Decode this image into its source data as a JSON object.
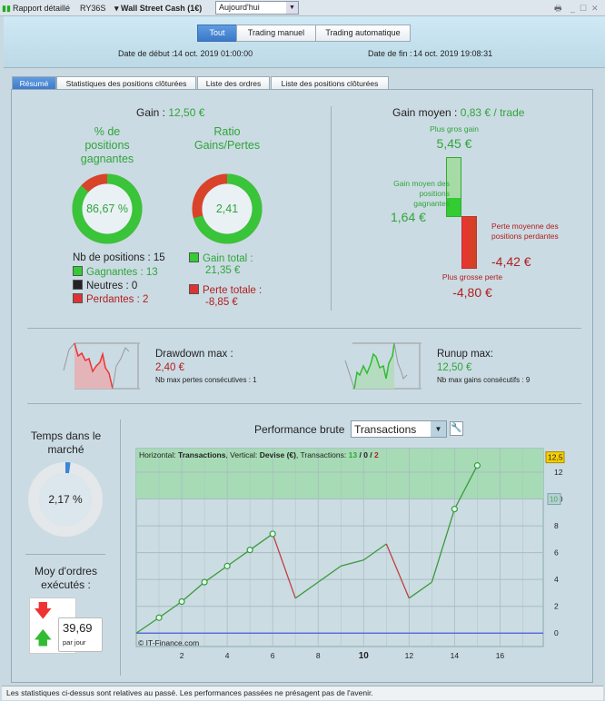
{
  "topbar": {
    "title": "Rapport détaillé",
    "account": "RY36S",
    "instrument": "Wall Street Cash (1€)",
    "period": "Aujourd'hui"
  },
  "header": {
    "filters": [
      "Tout",
      "Trading manuel",
      "Trading automatique"
    ],
    "start_label": "Date de début :",
    "start_value": "14 oct. 2019 01:00:00",
    "end_label": "Date de fin :",
    "end_value": "14 oct. 2019 19:08:31"
  },
  "tabs": [
    "Résumé",
    "Statistiques des positions clôturées",
    "Liste des ordres",
    "Liste des positions clôturées"
  ],
  "summary": {
    "gain_label": "Gain :",
    "gain_value": "12,50 €",
    "win_title": "% de positions gagnantes",
    "win_value": "86,67 %",
    "win_fraction": 0.8667,
    "ratio_title": "Ratio Gains/Pertes",
    "ratio_value": "2,41",
    "ratio_win_share": 0.707,
    "nb_positions": "Nb de positions : 15",
    "winners": "Gagnantes : 13",
    "neutral": "Neutres : 0",
    "losers": "Perdantes : 2",
    "gain_total_label": "Gain total :",
    "gain_total_value": "21,35 €",
    "loss_total_label": "Perte totale :",
    "loss_total_value": "-8,85 €"
  },
  "average": {
    "label": "Gain moyen :",
    "value": "0,83 € / trade",
    "max_gain_label": "Plus gros gain",
    "max_gain_value": "5,45 €",
    "avg_win_label": "Gain moyen des positions gagnantes",
    "avg_win_value": "1,64 €",
    "avg_loss_label": "Perte moyenne des positions perdantes",
    "avg_loss_value": "-4,42 €",
    "max_loss_label": "Plus grosse perte",
    "max_loss_value": "-4,80 €"
  },
  "drawdown": {
    "label": "Drawdown max :",
    "value": "2,40 €",
    "sub": "Nb max pertes consécutives : 1"
  },
  "runup": {
    "label": "Runup max:",
    "value": "12,50 €",
    "sub": "Nb max gains consécutifs : 9"
  },
  "time_market": {
    "label": "Temps dans le marché",
    "value": "2,17 %",
    "fraction": 0.0217
  },
  "orders": {
    "label": "Moy d'ordres exécutés :",
    "value": "39,69",
    "unit": "par jour"
  },
  "perf": {
    "title": "Performance brute",
    "select": "Transactions",
    "info_h": "Horizontal:",
    "info_h_v": "Transactions",
    "info_v": ", Vertical:",
    "info_v_v": "Devise (€)",
    "info_t": ", Transactions:",
    "t_win": "13",
    "t_sep1": " / ",
    "t_neu": "0",
    "t_sep2": " / ",
    "t_loss": "2",
    "copyright": "© IT-Finance.com"
  },
  "chart_data": {
    "type": "line",
    "xlabel": "",
    "ylabel": "",
    "xlim": [
      0,
      17.9
    ],
    "ylim": [
      -1,
      13.76
    ],
    "grid": true,
    "x": [
      0,
      1,
      2,
      3,
      4,
      5,
      6,
      7,
      8,
      9,
      10,
      11,
      12,
      13,
      14,
      15
    ],
    "y": [
      0,
      1.15,
      2.35,
      3.8,
      5.0,
      6.2,
      7.4,
      2.6,
      3.8,
      5.0,
      5.45,
      6.65,
      2.6,
      3.8,
      9.25,
      12.5
    ],
    "markers_at": [
      1,
      2,
      3,
      4,
      5,
      6,
      14,
      15
    ],
    "x_ticks": [
      2,
      4,
      6,
      8,
      10,
      12,
      14,
      16
    ],
    "y_ticks": [
      0,
      2,
      4,
      6,
      8,
      10,
      12
    ],
    "zone_above": 10,
    "zone_label": "10",
    "last_value_label": "12,5",
    "colors": {
      "up": "#3a9a3a",
      "down": "#c04040",
      "zero": "#4a5ae0",
      "zone": "#a6dbb5"
    }
  },
  "footer": "Les statistiques ci-dessus sont relatives au passé. Les performances passées ne présagent pas de l'avenir."
}
